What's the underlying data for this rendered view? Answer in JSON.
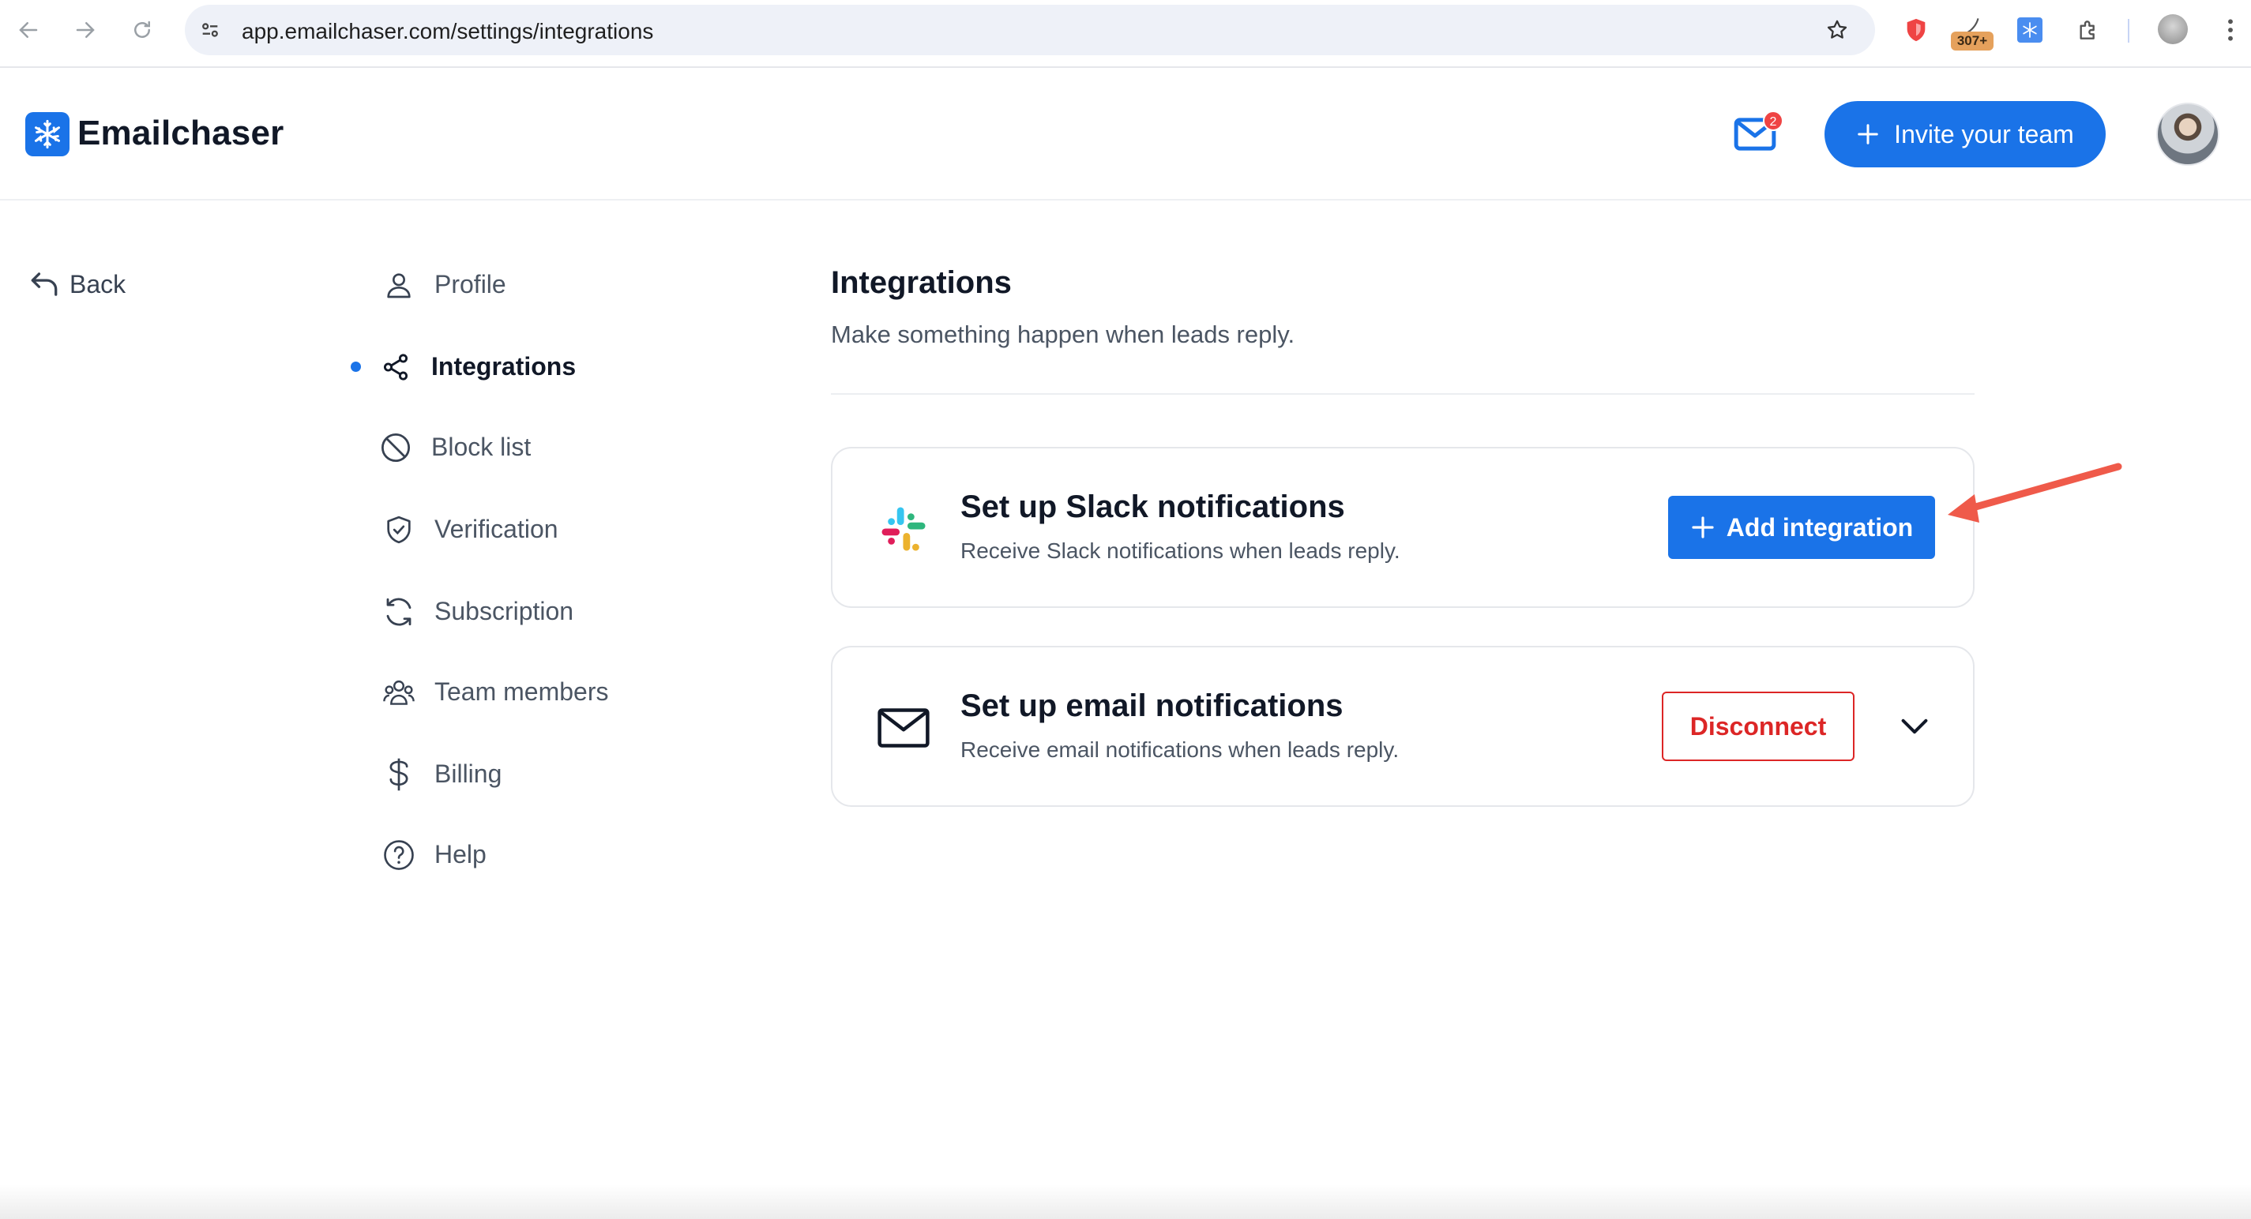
{
  "browser": {
    "url": "app.emailchaser.com/settings/integrations",
    "extension_badge": "307+"
  },
  "header": {
    "brand": "Emailchaser",
    "mail_badge_count": "2",
    "invite_label": "Invite your team"
  },
  "back_label": "Back",
  "nav": {
    "items": [
      {
        "label": "Profile",
        "icon": "user-icon"
      },
      {
        "label": "Integrations",
        "icon": "share-icon",
        "active": true
      },
      {
        "label": "Block list",
        "icon": "block-icon"
      },
      {
        "label": "Verification",
        "icon": "shield-check-icon"
      },
      {
        "label": "Subscription",
        "icon": "refresh-icon"
      },
      {
        "label": "Team members",
        "icon": "team-icon"
      },
      {
        "label": "Billing",
        "icon": "dollar-icon"
      },
      {
        "label": "Help",
        "icon": "help-icon"
      }
    ]
  },
  "main": {
    "title": "Integrations",
    "subtitle": "Make something happen when leads reply.",
    "cards": [
      {
        "title": "Set up Slack notifications",
        "description": "Receive Slack notifications when leads reply.",
        "action_label": "Add integration",
        "icon": "slack-icon"
      },
      {
        "title": "Set up email notifications",
        "description": "Receive email notifications when leads reply.",
        "action_label": "Disconnect",
        "icon": "envelope-icon"
      }
    ]
  },
  "colors": {
    "accent": "#1a73e8",
    "danger": "#dc2626",
    "annotation_arrow": "#ef5a4a"
  }
}
